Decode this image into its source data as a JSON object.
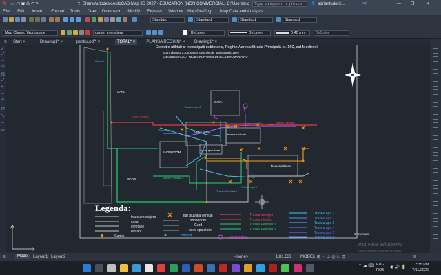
{
  "window": {
    "title": "Autodesk AutoCAD Map 3D 2027 - EDUCATION (NON COMMERCIAL)   C:\\Users\\nicol...\\TOTAL.dwg",
    "share_label": "Share",
    "search_placeholder": "Type a keyword or phrase",
    "user": "adriantudoric..."
  },
  "menu": [
    "File",
    "Edit",
    "Insert",
    "Format",
    "Tools",
    "Draw",
    "Dimension",
    "Modify",
    "Express",
    "Window",
    "Map Drafting",
    "Map Data and Analysis"
  ],
  "ribbon": {
    "workspace": "Map Classic Workspace",
    "layer": "camin_menajera",
    "linetype_style": "Standard",
    "dim_style": "Standard",
    "table_style": "Standard",
    "mleader_style": "Standard",
    "layer_color": "ByLayer",
    "linetype": "ByLayer",
    "lineweight": "0.40 mm",
    "plot_style": "ByColor"
  },
  "file_tabs": [
    {
      "label": "Start",
      "active": false
    },
    {
      "label": "Drawing1*",
      "active": false
    },
    {
      "label": "pentru.pdf*",
      "active": false
    },
    {
      "label": "TOTAL*",
      "active": true
    },
    {
      "label": "PLANSA REGHIN*",
      "active": false
    },
    {
      "label": "Drawing1*",
      "active": false
    }
  ],
  "drawing": {
    "title": "Detectie utilitati si investigatii subterane, Reghin,Adresa:Strada Principală nr. 160, sat Morăreni",
    "scale_line": "Scara planului 1:200/Sistem de proiectie \"Stereografic 1970\"",
    "executant": "Executant GALAXY IMOB GRUP-WWW.DETECTIEROMANIA.RO",
    "labels": {
      "hidrant": "Hidrant",
      "gard_top": "GARD",
      "gard_bottom": "GARD",
      "casa": "CASA",
      "cofetarie": "COFETARIE",
      "showroom": "SHOWROOM",
      "boxe1": "boxe spalatorie",
      "boxe2": "boxe spalatorie",
      "boxe3": "boxe spalatorie",
      "traseu_apa3": "Traseu apa 3",
      "traseu_apa4": "Traseu apa 4",
      "traseu_apa5": "Traseu apa 5",
      "traseu_apa1": "Traseu apa 1",
      "traseu_pluviala1": "Traseu Pluviala 1",
      "traseu_pluviala2": "Traseu Pluviala 2",
      "traseu_menajer": "Traseu menajer",
      "traseu_electric": "Traseu electric",
      "showroom_corner": "showroom"
    }
  },
  "legend": {
    "title": "Legenda:",
    "left_items": [
      "traseu menajera",
      "casa",
      "cofetarie",
      "hidrant"
    ],
    "camin_label": "Camin",
    "mid_items": [
      "tub pluviala vertical",
      "showroom",
      "Gard",
      "boxe spalatorie"
    ],
    "mid_bottom": "Hidrant",
    "capac_label": "capac rigola",
    "right_a": [
      "Traseu menajer",
      "Traseu electric",
      "Traseu Pluviala 1",
      "Traseu Pluviala 2"
    ],
    "right_b": [
      "Traseu apa 1",
      "Traseu apa 2",
      "Traseu apa 3",
      "Traseu apa 4",
      "Traseu apa 5",
      "Traseu apa 6"
    ]
  },
  "watermark": {
    "line1": "Activate Windows",
    "line2": "Go to Settings to activate Windows."
  },
  "status": {
    "model": "Model",
    "layout1": "Layout1",
    "layout2": "Layout2",
    "model_right": "MODEL",
    "scale": "1:81.539",
    "none": "<none>",
    "lang": "ENG",
    "region": "ROS",
    "time": "2:35 PM",
    "date": "7/11/2026"
  }
}
